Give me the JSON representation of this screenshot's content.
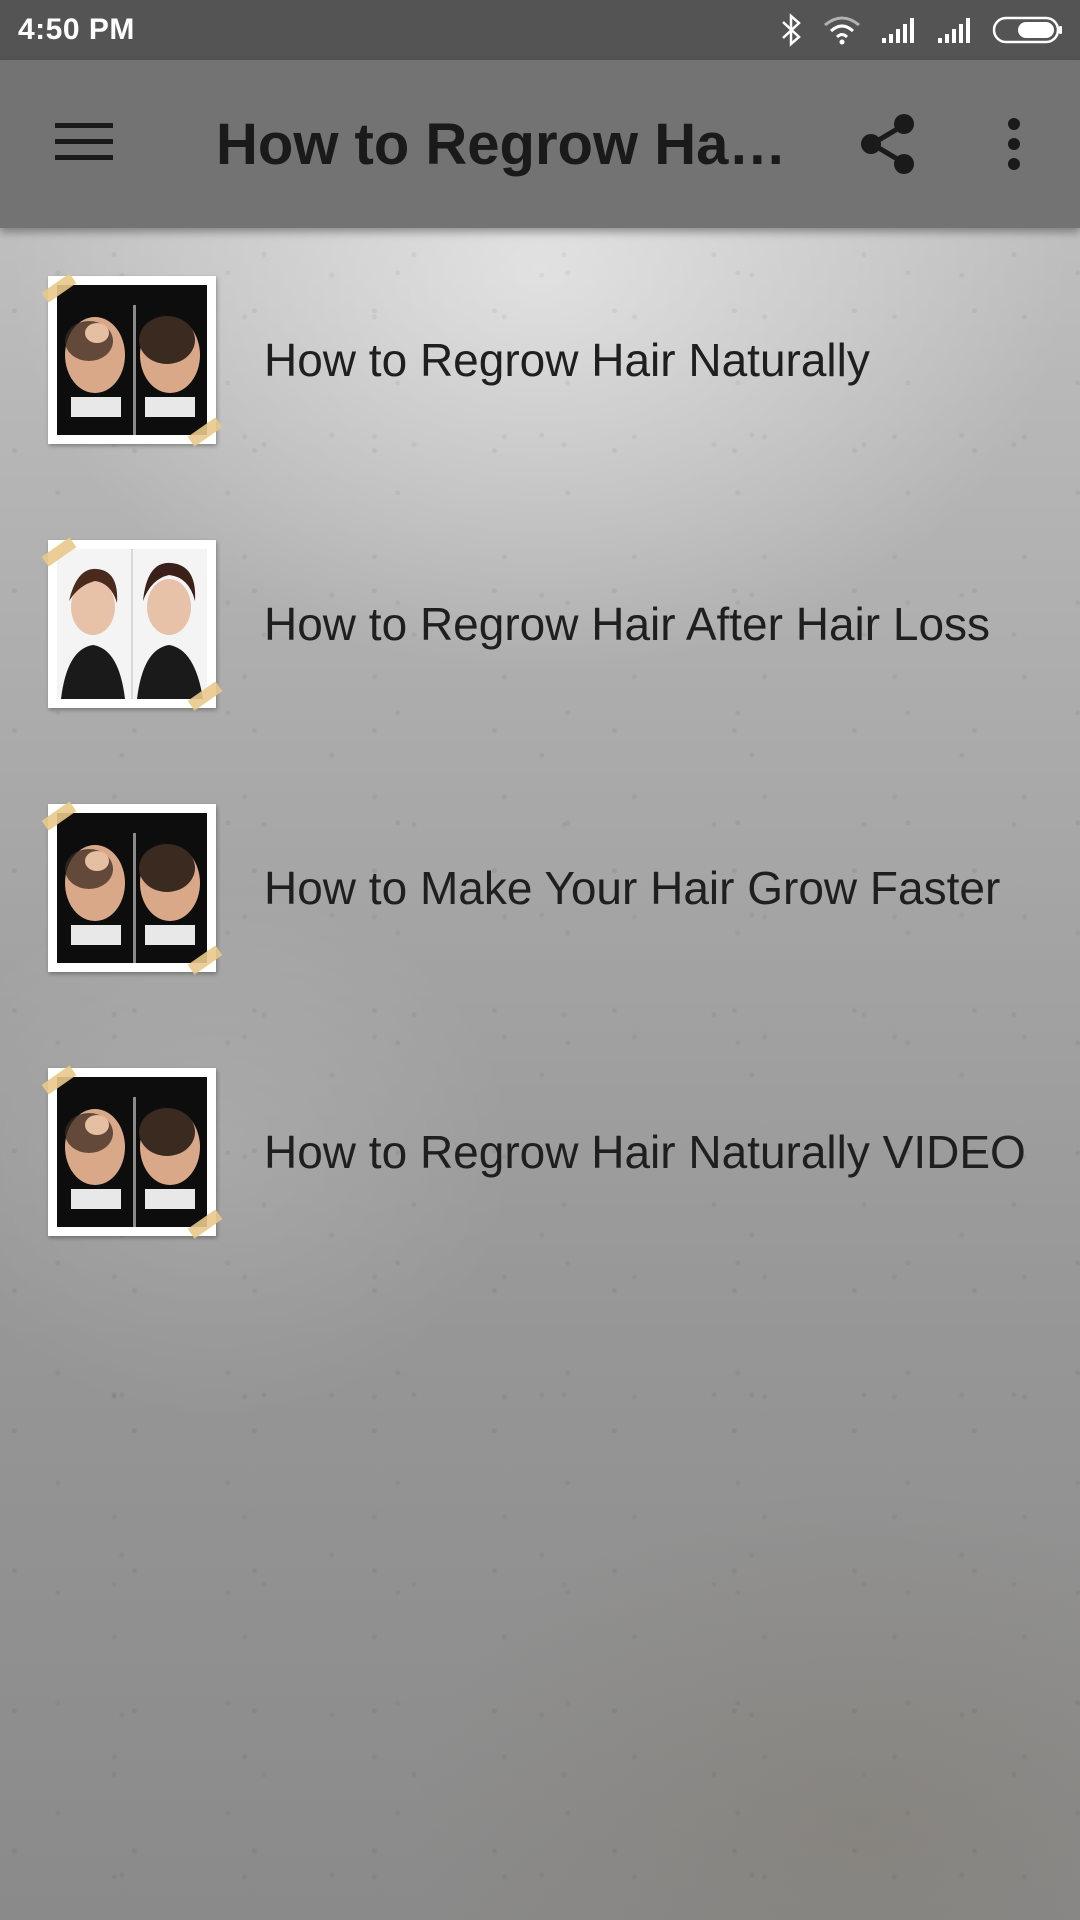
{
  "status_bar": {
    "time": "4:50 PM",
    "icons": [
      "bluetooth-icon",
      "wifi-icon",
      "signal-icon",
      "signal-icon",
      "battery-icon"
    ]
  },
  "app_bar": {
    "title": "How to Regrow Hair Naturally",
    "menu_icon": "hamburger-menu-icon",
    "share_icon": "share-icon",
    "more_icon": "more-vertical-icon",
    "background_color": "#737373"
  },
  "list": {
    "items": [
      {
        "label": "How to Regrow Hair Naturally",
        "thumbnail": "men-hair-before-after"
      },
      {
        "label": "How to Regrow Hair After Hair Loss",
        "thumbnail": "woman-hair-before-after"
      },
      {
        "label": "How to Make Your Hair Grow Faster",
        "thumbnail": "men-hair-before-after"
      },
      {
        "label": "How to Regrow Hair Naturally VIDEO",
        "thumbnail": "men-hair-before-after"
      }
    ]
  }
}
